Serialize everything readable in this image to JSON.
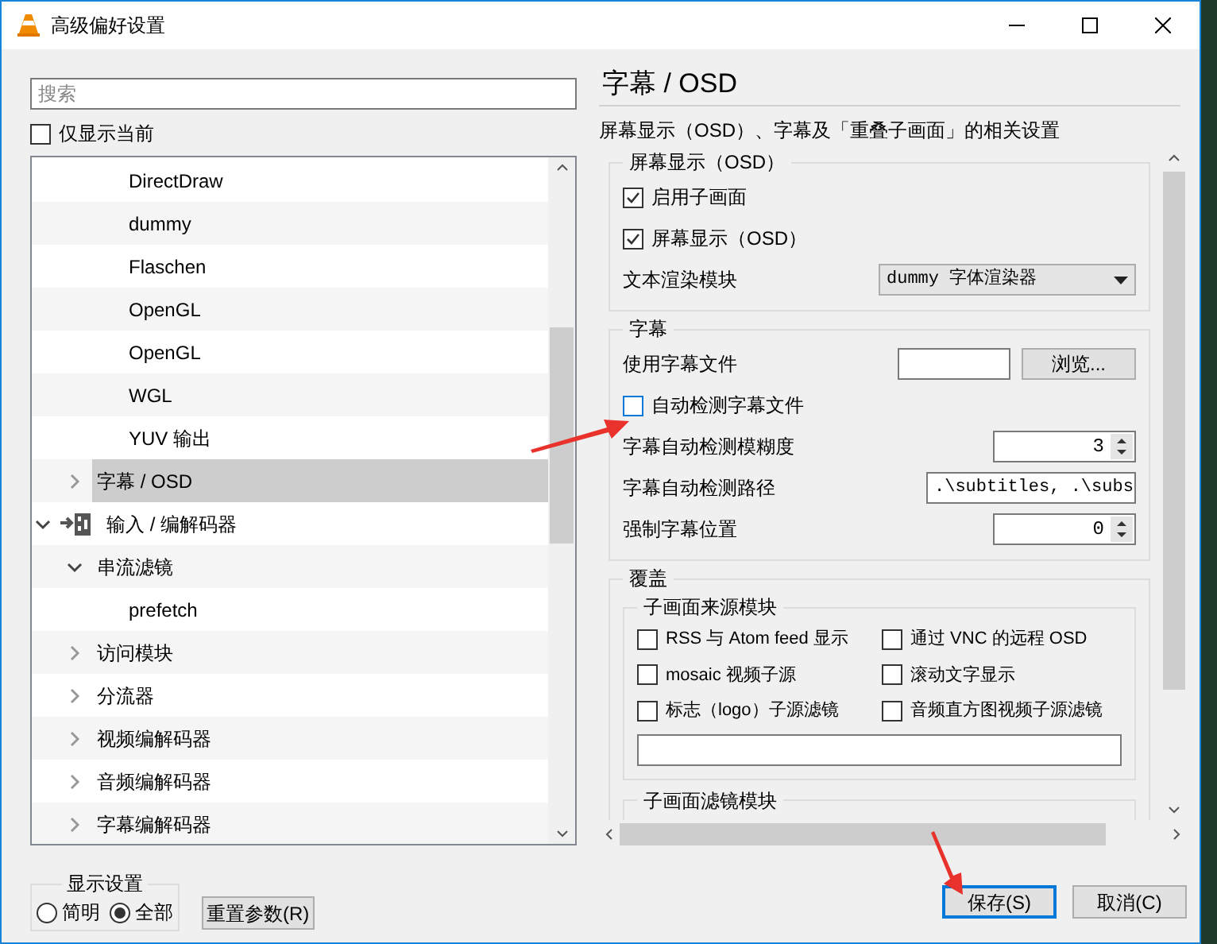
{
  "window": {
    "title": "高级偏好设置"
  },
  "search": {
    "placeholder": "搜索"
  },
  "only_current": {
    "label": "仅显示当前",
    "checked": false
  },
  "tree": [
    {
      "children": [
        {
          "children": [
            {
              "label": "DirectDraw",
              "selected": false
            },
            {
              "label": "dummy",
              "selected": false
            },
            {
              "label": "Flaschen",
              "selected": false
            },
            {
              "label": "OpenGL",
              "selected": false
            },
            {
              "label": "OpenGL",
              "selected": false
            },
            {
              "label": "WGL",
              "selected": false
            },
            {
              "label": "YUV 输出",
              "selected": false
            }
          ]
        },
        {
          "label": "字幕 / OSD",
          "expanded": false,
          "selected": true
        }
      ]
    },
    {
      "label": "输入 / 编解码器",
      "expanded": true,
      "selected": false,
      "children": [
        {
          "label": "串流滤镜",
          "expanded": true,
          "selected": false,
          "children": [
            {
              "label": "prefetch",
              "selected": false
            }
          ]
        },
        {
          "label": "访问模块",
          "expanded": false,
          "selected": false
        },
        {
          "label": "分流器",
          "expanded": false,
          "selected": false
        },
        {
          "label": "视频编解码器",
          "expanded": false,
          "selected": false
        },
        {
          "label": "音频编解码器",
          "expanded": false,
          "selected": false
        },
        {
          "label": "字幕编解码器",
          "expanded": false,
          "selected": false
        }
      ]
    }
  ],
  "display_settings": {
    "title": "显示设置",
    "options": [
      {
        "label": "简明",
        "selected": false
      },
      {
        "label": "全部",
        "selected": true
      }
    ]
  },
  "reset_button": "重置参数(R)",
  "panel": {
    "title": "字幕 / OSD",
    "description": "屏幕显示（OSD）、字幕及「重叠子画面」的相关设置"
  },
  "groups": [
    {
      "title": "屏幕显示（OSD）",
      "rows": [
        {
          "kind": "checkbox",
          "label": "启用子画面",
          "checked": true
        },
        {
          "kind": "checkbox",
          "label": "屏幕显示（OSD）",
          "checked": true
        },
        {
          "kind": "select",
          "label": "文本渲染模块",
          "value": "dummy 字体渲染器"
        }
      ]
    },
    {
      "title": "字幕",
      "rows": [
        {
          "kind": "file",
          "label": "使用字幕文件",
          "button": "浏览..."
        },
        {
          "kind": "checkbox",
          "label": "自动检测字幕文件",
          "checked": false
        },
        {
          "kind": "spin",
          "label": "字幕自动检测模糊度",
          "value": "3"
        },
        {
          "kind": "text",
          "label": "字幕自动检测路径",
          "value": ".\\subtitles, .\\subs"
        },
        {
          "kind": "spin",
          "label": "强制字幕位置",
          "value": "0"
        }
      ]
    },
    {
      "title": "覆盖",
      "subgroups": [
        {
          "title": "子画面来源模块",
          "options": [
            {
              "label": "RSS 与 Atom feed 显示",
              "checked": false
            },
            {
              "label": "通过 VNC 的远程 OSD",
              "checked": false
            },
            {
              "label": "mosaic 视频子源",
              "checked": false
            },
            {
              "label": "滚动文字显示",
              "checked": false
            },
            {
              "label": "标志（logo）子源滤镜",
              "checked": false
            },
            {
              "label": "音频直方图视频子源滤镜",
              "checked": false
            }
          ]
        },
        {
          "title": "子画面滤镜模块"
        }
      ]
    }
  ],
  "buttons": [
    {
      "label": "保存(S)",
      "default": true
    },
    {
      "label": "取消(C)",
      "default": false
    }
  ]
}
